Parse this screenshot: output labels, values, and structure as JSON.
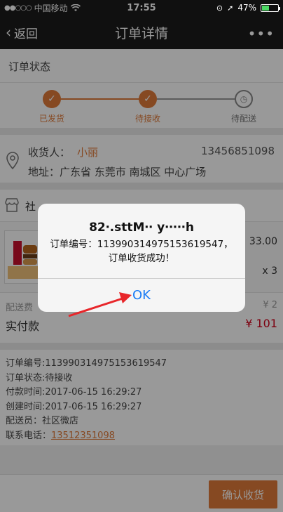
{
  "status_bar": {
    "carrier": "中国移动",
    "time": "17:55",
    "battery_pct": "47%",
    "battery_level": 0.47
  },
  "nav": {
    "back_label": "返回",
    "title": "订单详情",
    "more_label": "•••"
  },
  "order_status": {
    "title": "订单状态",
    "steps": [
      {
        "label": "已发货",
        "state": "done"
      },
      {
        "label": "待接收",
        "state": "done"
      },
      {
        "label": "待配送",
        "state": "todo"
      }
    ]
  },
  "address": {
    "recipient_label": "收货人：",
    "recipient_name": "小丽",
    "phone": "13456851098",
    "address_text": "地址：广东省 东莞市 南城区 中心广场"
  },
  "shop": {
    "name_partial": "社"
  },
  "goods": {
    "price": "33.00",
    "quantity": "x 3"
  },
  "payment": {
    "delivery_fee_label": "配送费",
    "delivery_fee": "¥ 2",
    "total_label": "实付款",
    "total": "¥ 101"
  },
  "order_info": {
    "order_no": "订单编号:113990314975153619547",
    "order_status": "订单状态:待接收",
    "pay_time": "付款时间:2017-06-15 16:29:27",
    "create_time": "创建时间:2017-06-15 16:29:27",
    "courier": "配送员：社区微店",
    "contact_label": "联系电话：",
    "contact_phone": "13512351098"
  },
  "bottom": {
    "confirm_label": "确认收货"
  },
  "dialog": {
    "title": "82‧.sttM‧‧ y‧‧‧‧‧h",
    "message_line1": "订单编号：113990314975153619547，",
    "message_line2": "订单收货成功！",
    "ok_label": "OK"
  },
  "colors": {
    "accent": "#e07a3a",
    "price_red": "#d0021b",
    "ios_blue": "#1a7cf5"
  }
}
